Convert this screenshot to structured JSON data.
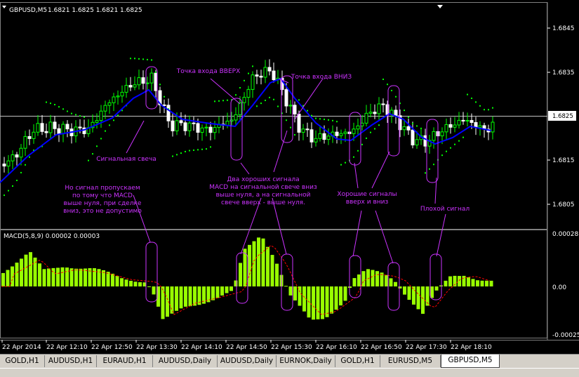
{
  "window": {
    "symbol_timeframe": "GBPUSD,M5",
    "quote_values": "1.6821 1.6825 1.6821 1.6825"
  },
  "price_axis": {
    "labels": [
      "1.6845",
      "1.6835",
      "1.6825",
      "1.6815",
      "1.6805"
    ],
    "current": "1.6825"
  },
  "indicator": {
    "label": "MACD(5,8,9) 0.00002 0.00003",
    "axis_labels": [
      "0.00028",
      "0.00",
      "-0.00025"
    ]
  },
  "time_axis": [
    "22 Apr 2014",
    "22 Apr 12:10",
    "22 Apr 12:50",
    "22 Apr 13:30",
    "22 Apr 14:10",
    "22 Apr 14:50",
    "22 Apr 15:30",
    "22 Apr 16:10",
    "22 Apr 16:50",
    "22 Apr 17:30",
    "22 Apr 18:10"
  ],
  "annotations": {
    "entry_up": "Точка входа ВВЕРХ",
    "entry_down": "Точка входа ВНИЗ",
    "signal_candle": "Сигнальная свеча",
    "missed_signal": [
      "Но сигнал пропускаем",
      "по тому что MACD",
      "выше нуля, при сделке",
      "вниз, это не допустимо"
    ],
    "two_good_signals": [
      "Два хороших сигнала",
      "MACD на сигнальной свече вниз",
      "выше нуля, а на сигнальной",
      "свече вверх - выше нуля."
    ],
    "good_signals": [
      "Хорошие сигналы",
      "вверх и вниз"
    ],
    "bad_signal": "Плохой сигнал"
  },
  "tabs": [
    {
      "label": "GOLD,H1",
      "active": false
    },
    {
      "label": "AUDUSD,H1",
      "active": false
    },
    {
      "label": "EURAUD,H1",
      "active": false
    },
    {
      "label": "AUDUSD,Daily",
      "active": false
    },
    {
      "label": "AUDUSD,Daily",
      "active": false
    },
    {
      "label": "EURNOK,Daily",
      "active": false
    },
    {
      "label": "GOLD,H1",
      "active": false
    },
    {
      "label": "EURUSD,M5",
      "active": false
    },
    {
      "label": "GBPUSD,M5",
      "active": true
    }
  ],
  "colors": {
    "background": "#000000",
    "bull_candle": "#00ff00",
    "bear_candle": "#ffffff",
    "moving_average": "#0000ff",
    "parabolic_sar": "#00ff00",
    "macd_histogram": "#99ff00",
    "macd_signal": "#ff0000",
    "annotation": "#cc33ff"
  }
}
